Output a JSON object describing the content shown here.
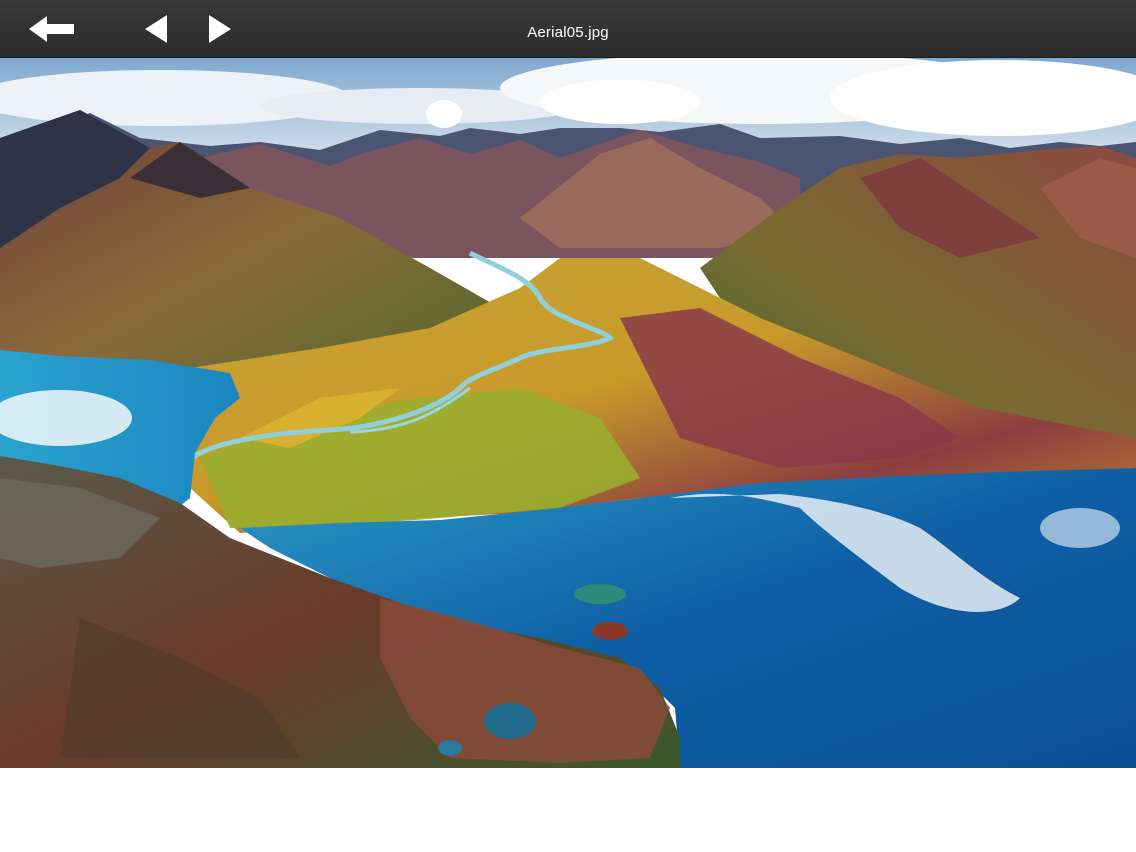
{
  "toolbar": {
    "title": "Aerial05.jpg",
    "buttons": [
      {
        "name": "back",
        "icon": "back-arrow-icon"
      },
      {
        "name": "previous",
        "icon": "triangle-left-icon"
      },
      {
        "name": "next",
        "icon": "triangle-right-icon"
      }
    ],
    "background_color": "#2f2f2f",
    "icon_color": "#ffffff"
  },
  "image": {
    "description_icon": "photo-image",
    "palette": {
      "sky": "#cfe0ee",
      "cloud": "#ffffff",
      "mountain_dark": "#3b3f52",
      "mountain_warm": "#8a5a4c",
      "valley_yellow": "#d7b72a",
      "valley_green": "#7a9a2c",
      "valley_red": "#8b3a4a",
      "lake_deep": "#0e5ea8",
      "lake_turquoise": "#27a7c9",
      "river": "#8fd0dc"
    }
  }
}
